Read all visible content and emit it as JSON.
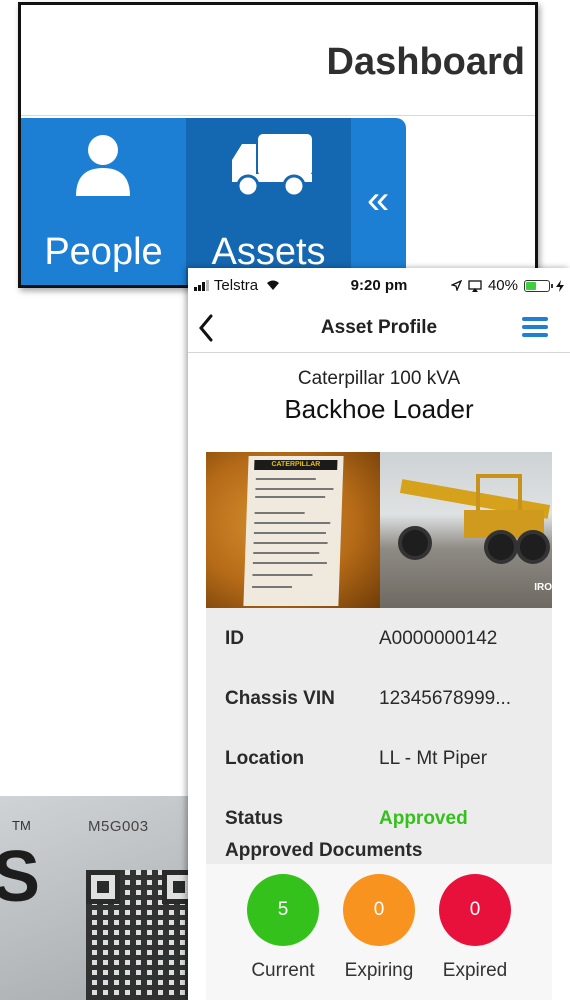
{
  "dashboard": {
    "title": "Dashboard",
    "nav": [
      {
        "label": "People",
        "icon": "person-icon"
      },
      {
        "label": "Assets",
        "icon": "truck-icon"
      }
    ],
    "collapse_glyph": "«"
  },
  "phone": {
    "status": {
      "carrier": "Telstra",
      "time": "9:20 pm",
      "battery": "40%",
      "battery_level": 0.4
    },
    "header": {
      "back_glyph": "‹",
      "title": "Asset Profile"
    },
    "asset": {
      "subtitle": "Caterpillar 100 kVA",
      "name": "Backhoe Loader",
      "plate_brand": "CATERPILLAR",
      "photo_watermark": "IRO"
    },
    "details": [
      {
        "label": "ID",
        "value": "A0000000142"
      },
      {
        "label": "Chassis VIN",
        "value": "12345678999..."
      },
      {
        "label": "Location",
        "value": "LL - Mt Piper"
      },
      {
        "label": "Status",
        "value": "Approved"
      }
    ],
    "documents": {
      "title": "Approved Documents",
      "items": [
        {
          "count": "5",
          "label": "Current",
          "color": "#35c11c"
        },
        {
          "count": "0",
          "label": "Expiring",
          "color": "#f7931e"
        },
        {
          "count": "0",
          "label": "Expired",
          "color": "#e8113c"
        }
      ]
    }
  },
  "background_label": {
    "tm": "TM",
    "letter": "S",
    "model": "M5G003"
  },
  "colors": {
    "accent": "#1c7fd3",
    "approved": "#35c11c"
  }
}
